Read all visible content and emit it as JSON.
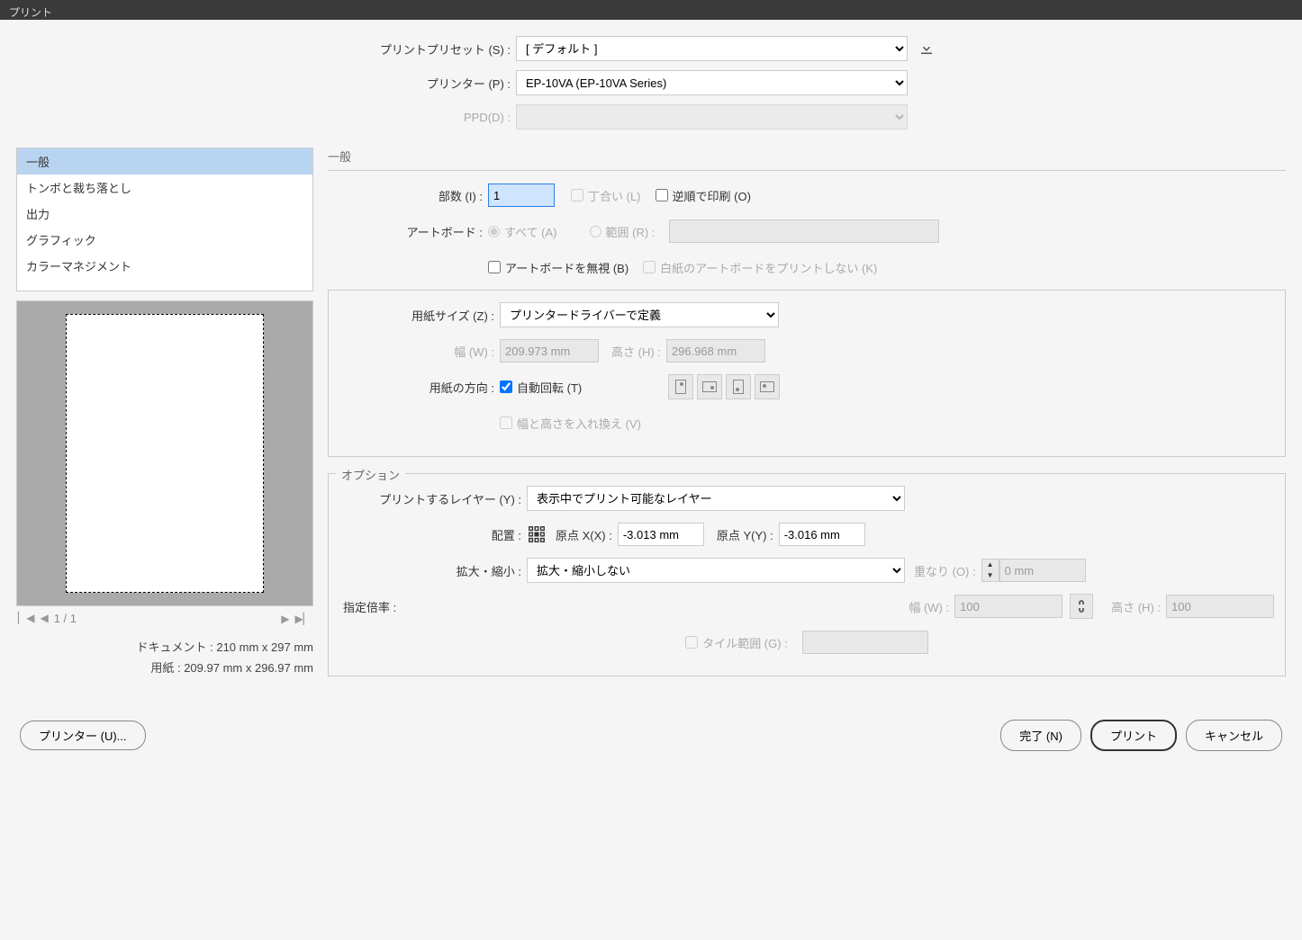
{
  "title": "プリント",
  "top": {
    "preset_label": "プリントプリセット (S) :",
    "preset_value": "[ デフォルト ]",
    "printer_label": "プリンター (P) :",
    "printer_value": "EP-10VA (EP-10VA Series)",
    "ppd_label": "PPD(D) :",
    "ppd_value": ""
  },
  "categories": [
    "一般",
    "トンボと裁ち落とし",
    "出力",
    "グラフィック",
    "カラーマネジメント"
  ],
  "preview": {
    "page_indicator": "1 / 1",
    "doc_label": "ドキュメント :",
    "doc_value": "210 mm x 297 mm",
    "paper_label": "用紙 :",
    "paper_value": "209.97 mm x 296.97 mm"
  },
  "general": {
    "section": "一般",
    "copies_label": "部数 (I) :",
    "copies_value": "1",
    "collate_label": "丁合い (L)",
    "reverse_label": "逆順で印刷 (O)",
    "artboard_label": "アートボード :",
    "artboard_all": "すべて (A)",
    "artboard_range": "範囲 (R) :",
    "ignore_artboard": "アートボードを無視 (B)",
    "skip_blank": "白紙のアートボードをプリントしない (K)",
    "paper_size_label": "用紙サイズ (Z) :",
    "paper_size_value": "プリンタードライバーで定義",
    "width_label": "幅 (W) :",
    "width_value": "209.973 mm",
    "height_label": "高さ (H) :",
    "height_value": "296.968 mm",
    "orient_label": "用紙の方向 :",
    "auto_rotate": "自動回転 (T)",
    "transpose": "幅と高さを入れ換え (V)"
  },
  "options": {
    "section": "オプション",
    "layers_label": "プリントするレイヤー (Y) :",
    "layers_value": "表示中でプリント可能なレイヤー",
    "placement_label": "配置 :",
    "origin_x_label": "原点 X(X) :",
    "origin_x_value": "-3.013 mm",
    "origin_y_label": "原点 Y(Y) :",
    "origin_y_value": "-3.016 mm",
    "scale_label": "拡大・縮小 :",
    "scale_value": "拡大・縮小しない",
    "overlap_label": "重なり (O) :",
    "overlap_value": "0 mm",
    "ratio_label": "指定倍率 :",
    "scale_w_label": "幅 (W) :",
    "scale_w_value": "100",
    "scale_h_label": "高さ (H) :",
    "scale_h_value": "100",
    "tile_range": "タイル範囲 (G) :"
  },
  "footer": {
    "printer_btn": "プリンター (U)...",
    "done": "完了 (N)",
    "print": "プリント",
    "cancel": "キャンセル"
  }
}
